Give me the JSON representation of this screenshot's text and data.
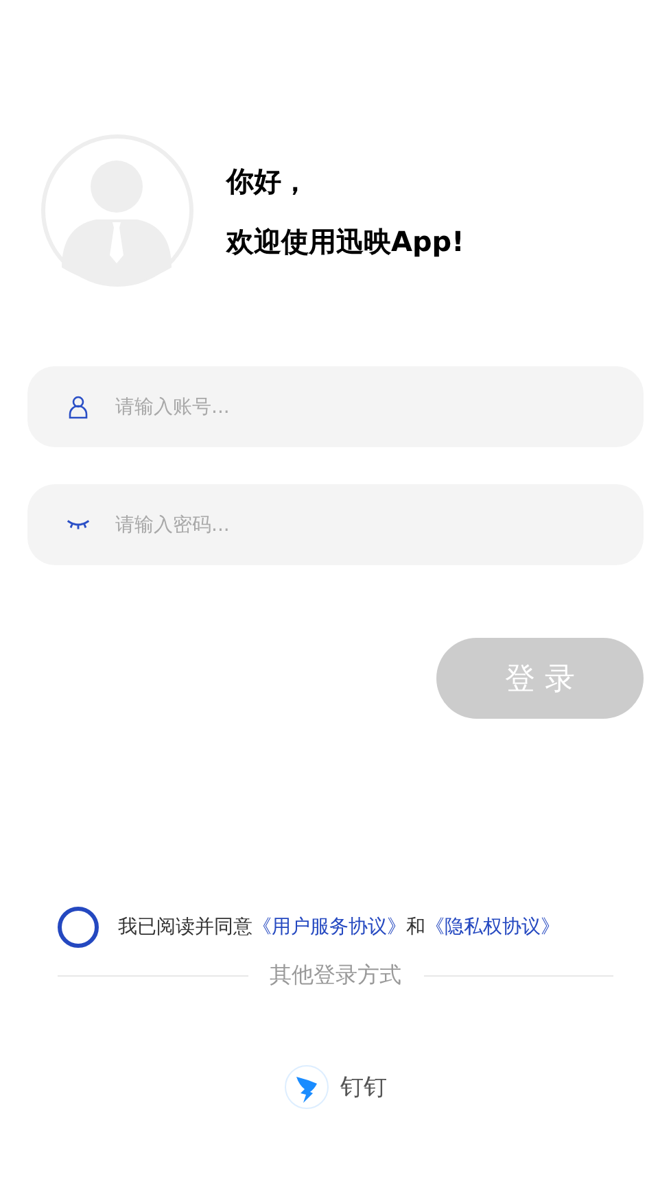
{
  "greeting": {
    "line_1": "你好，",
    "line_2": "欢迎使用迅映App!"
  },
  "fields": [
    {
      "kind": "account",
      "placeholder": "请输入账号..."
    },
    {
      "kind": "password",
      "placeholder": "请输入密码..."
    }
  ],
  "login_button": {
    "label": "登 录",
    "disabled": true
  },
  "agreement": {
    "checked": false,
    "text": "我已阅读并同意",
    "link_1": "《用户服务协议》",
    "joiner": "和",
    "link_2": "《隐私权协议》"
  },
  "other_login": {
    "heading": "其他登录方式",
    "options": [
      {
        "label": "钉钉"
      }
    ]
  }
}
